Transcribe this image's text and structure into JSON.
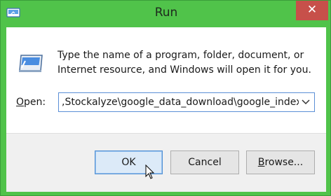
{
  "window": {
    "title": "Run",
    "close_glyph": "✕"
  },
  "dialog": {
    "description": "Type the name of a program, folder, document, or Internet resource, and Windows will open it for you.",
    "open_label_underlined": "O",
    "open_label_rest": "pen:",
    "open_value": ",Stockalyze\\google_data_download\\google_index",
    "icons": {
      "app": "run-app-icon",
      "run": "run-dialog-icon",
      "dropdown": "chevron-down-icon",
      "cursor": "mouse-pointer-icon"
    }
  },
  "buttons": {
    "ok": "OK",
    "cancel": "Cancel",
    "browse_underlined": "B",
    "browse_rest": "rowse..."
  },
  "colors": {
    "accent_frame": "#50c34a",
    "close_button": "#c7504a",
    "focus_border": "#5b8fd6"
  }
}
